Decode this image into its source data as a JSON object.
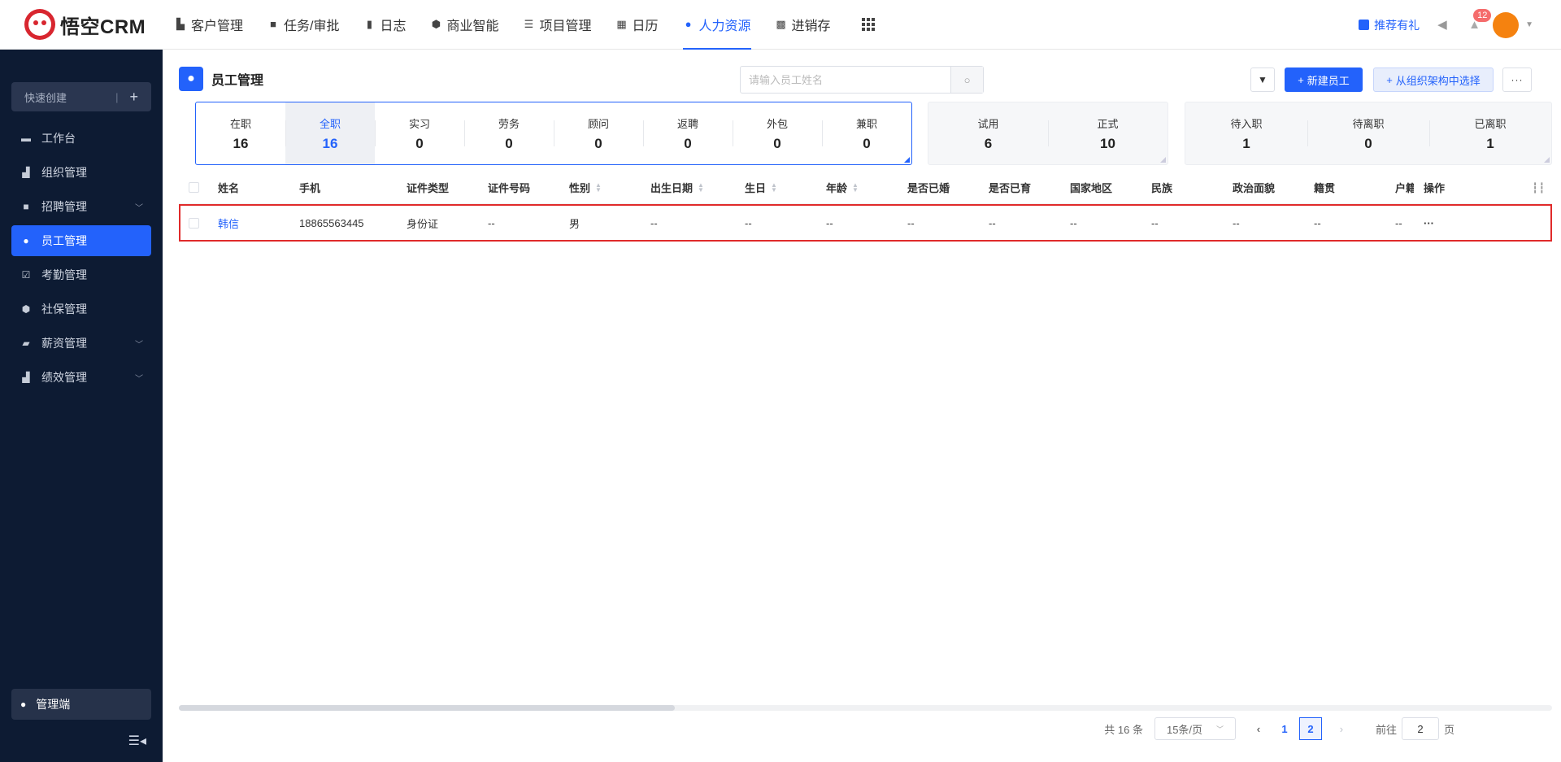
{
  "app": {
    "logo_text": "悟空CRM"
  },
  "nav": {
    "items": [
      {
        "label": "客户管理",
        "icon": "building-icon"
      },
      {
        "label": "任务/审批",
        "icon": "briefcase-icon"
      },
      {
        "label": "日志",
        "icon": "note-icon"
      },
      {
        "label": "商业智能",
        "icon": "shield-icon"
      },
      {
        "label": "项目管理",
        "icon": "list-icon"
      },
      {
        "label": "日历",
        "icon": "calendar-icon"
      },
      {
        "label": "人力资源",
        "icon": "users-icon",
        "active": true
      },
      {
        "label": "进销存",
        "icon": "warehouse-icon"
      }
    ],
    "gift_label": "推荐有礼",
    "notification_count": "12"
  },
  "sidebar": {
    "quick_create": "快速创建",
    "items": [
      {
        "label": "工作台",
        "icon": "monitor-icon"
      },
      {
        "label": "组织管理",
        "icon": "org-icon"
      },
      {
        "label": "招聘管理",
        "icon": "briefcase-icon",
        "expandable": true
      },
      {
        "label": "员工管理",
        "icon": "user-icon",
        "active": true
      },
      {
        "label": "考勤管理",
        "icon": "check-calendar-icon"
      },
      {
        "label": "社保管理",
        "icon": "shield-icon"
      },
      {
        "label": "薪资管理",
        "icon": "wallet-icon",
        "expandable": true
      },
      {
        "label": "绩效管理",
        "icon": "chart-icon",
        "expandable": true
      }
    ],
    "admin_label": "管理端"
  },
  "page": {
    "title": "员工管理",
    "search_placeholder": "请输入员工姓名",
    "new_button": "新建员工",
    "org_button": "从组织架构中选择"
  },
  "stats": {
    "group1": [
      {
        "label": "在职",
        "value": "16"
      },
      {
        "label": "全职",
        "value": "16",
        "selected": true
      },
      {
        "label": "实习",
        "value": "0"
      },
      {
        "label": "劳务",
        "value": "0"
      },
      {
        "label": "顾问",
        "value": "0"
      },
      {
        "label": "返聘",
        "value": "0"
      },
      {
        "label": "外包",
        "value": "0"
      },
      {
        "label": "兼职",
        "value": "0"
      }
    ],
    "group2": [
      {
        "label": "试用",
        "value": "6"
      },
      {
        "label": "正式",
        "value": "10"
      }
    ],
    "group3": [
      {
        "label": "待入职",
        "value": "1"
      },
      {
        "label": "待离职",
        "value": "0"
      },
      {
        "label": "已离职",
        "value": "1"
      }
    ]
  },
  "table": {
    "columns": [
      "姓名",
      "手机",
      "证件类型",
      "证件号码",
      "性别",
      "出生日期",
      "生日",
      "年龄",
      "是否已婚",
      "是否已育",
      "国家地区",
      "民族",
      "政治面貌",
      "籍贯",
      "户籍",
      "操作"
    ],
    "rows": [
      [
        "韩信",
        "18865563445",
        "身份证",
        "--",
        "男",
        "--",
        "--",
        "--",
        "--",
        "--",
        "--",
        "--",
        "--",
        "--",
        "--",
        "···"
      ]
    ]
  },
  "pager": {
    "total": "共 16 条",
    "page_size": "15条/页",
    "pages": [
      "1",
      "2"
    ],
    "current": "2",
    "goto_label": "前往",
    "goto_value": "2",
    "goto_suffix": "页"
  }
}
